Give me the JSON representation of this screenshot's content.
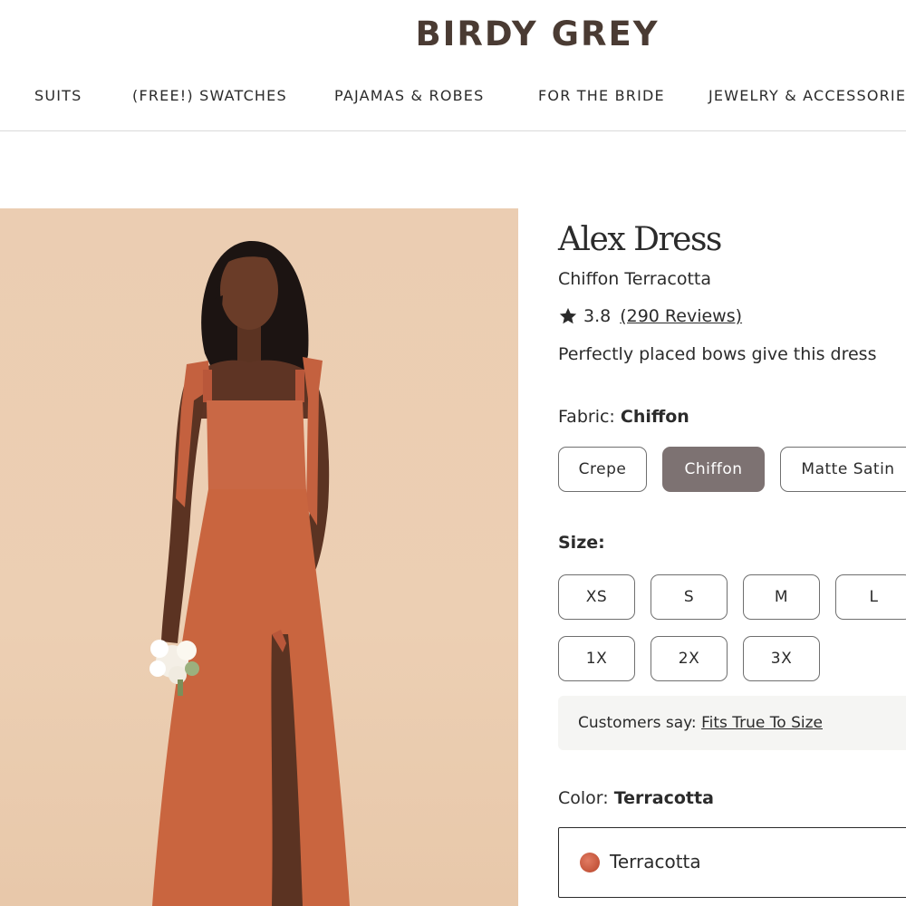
{
  "header": {
    "logo": "BIRDY GREY",
    "nav": [
      "SUITS",
      "(FREE!) SWATCHES",
      "PAJAMAS & ROBES",
      "FOR THE BRIDE",
      "JEWELRY & ACCESSORIES"
    ]
  },
  "product": {
    "title": "Alex Dress",
    "subtitle": "Chiffon Terracotta",
    "rating": "3.8",
    "reviews": "(290 Reviews)",
    "description": "Perfectly placed bows give this dress"
  },
  "fabric": {
    "label": "Fabric:",
    "selected": "Chiffon",
    "options": [
      "Crepe",
      "Chiffon",
      "Matte Satin"
    ]
  },
  "size": {
    "label": "Size:",
    "options": [
      "XS",
      "S",
      "M",
      "L",
      "1X",
      "2X",
      "3X"
    ]
  },
  "fit": {
    "prefix": "Customers say:",
    "link": "Fits True To Size"
  },
  "color": {
    "label": "Color:",
    "selected": "Terracotta",
    "option": "Terracotta",
    "swatch_hex": "#c95a3f"
  },
  "icons": {
    "rating": "star-icon",
    "swatch": "color-swatch-icon"
  }
}
